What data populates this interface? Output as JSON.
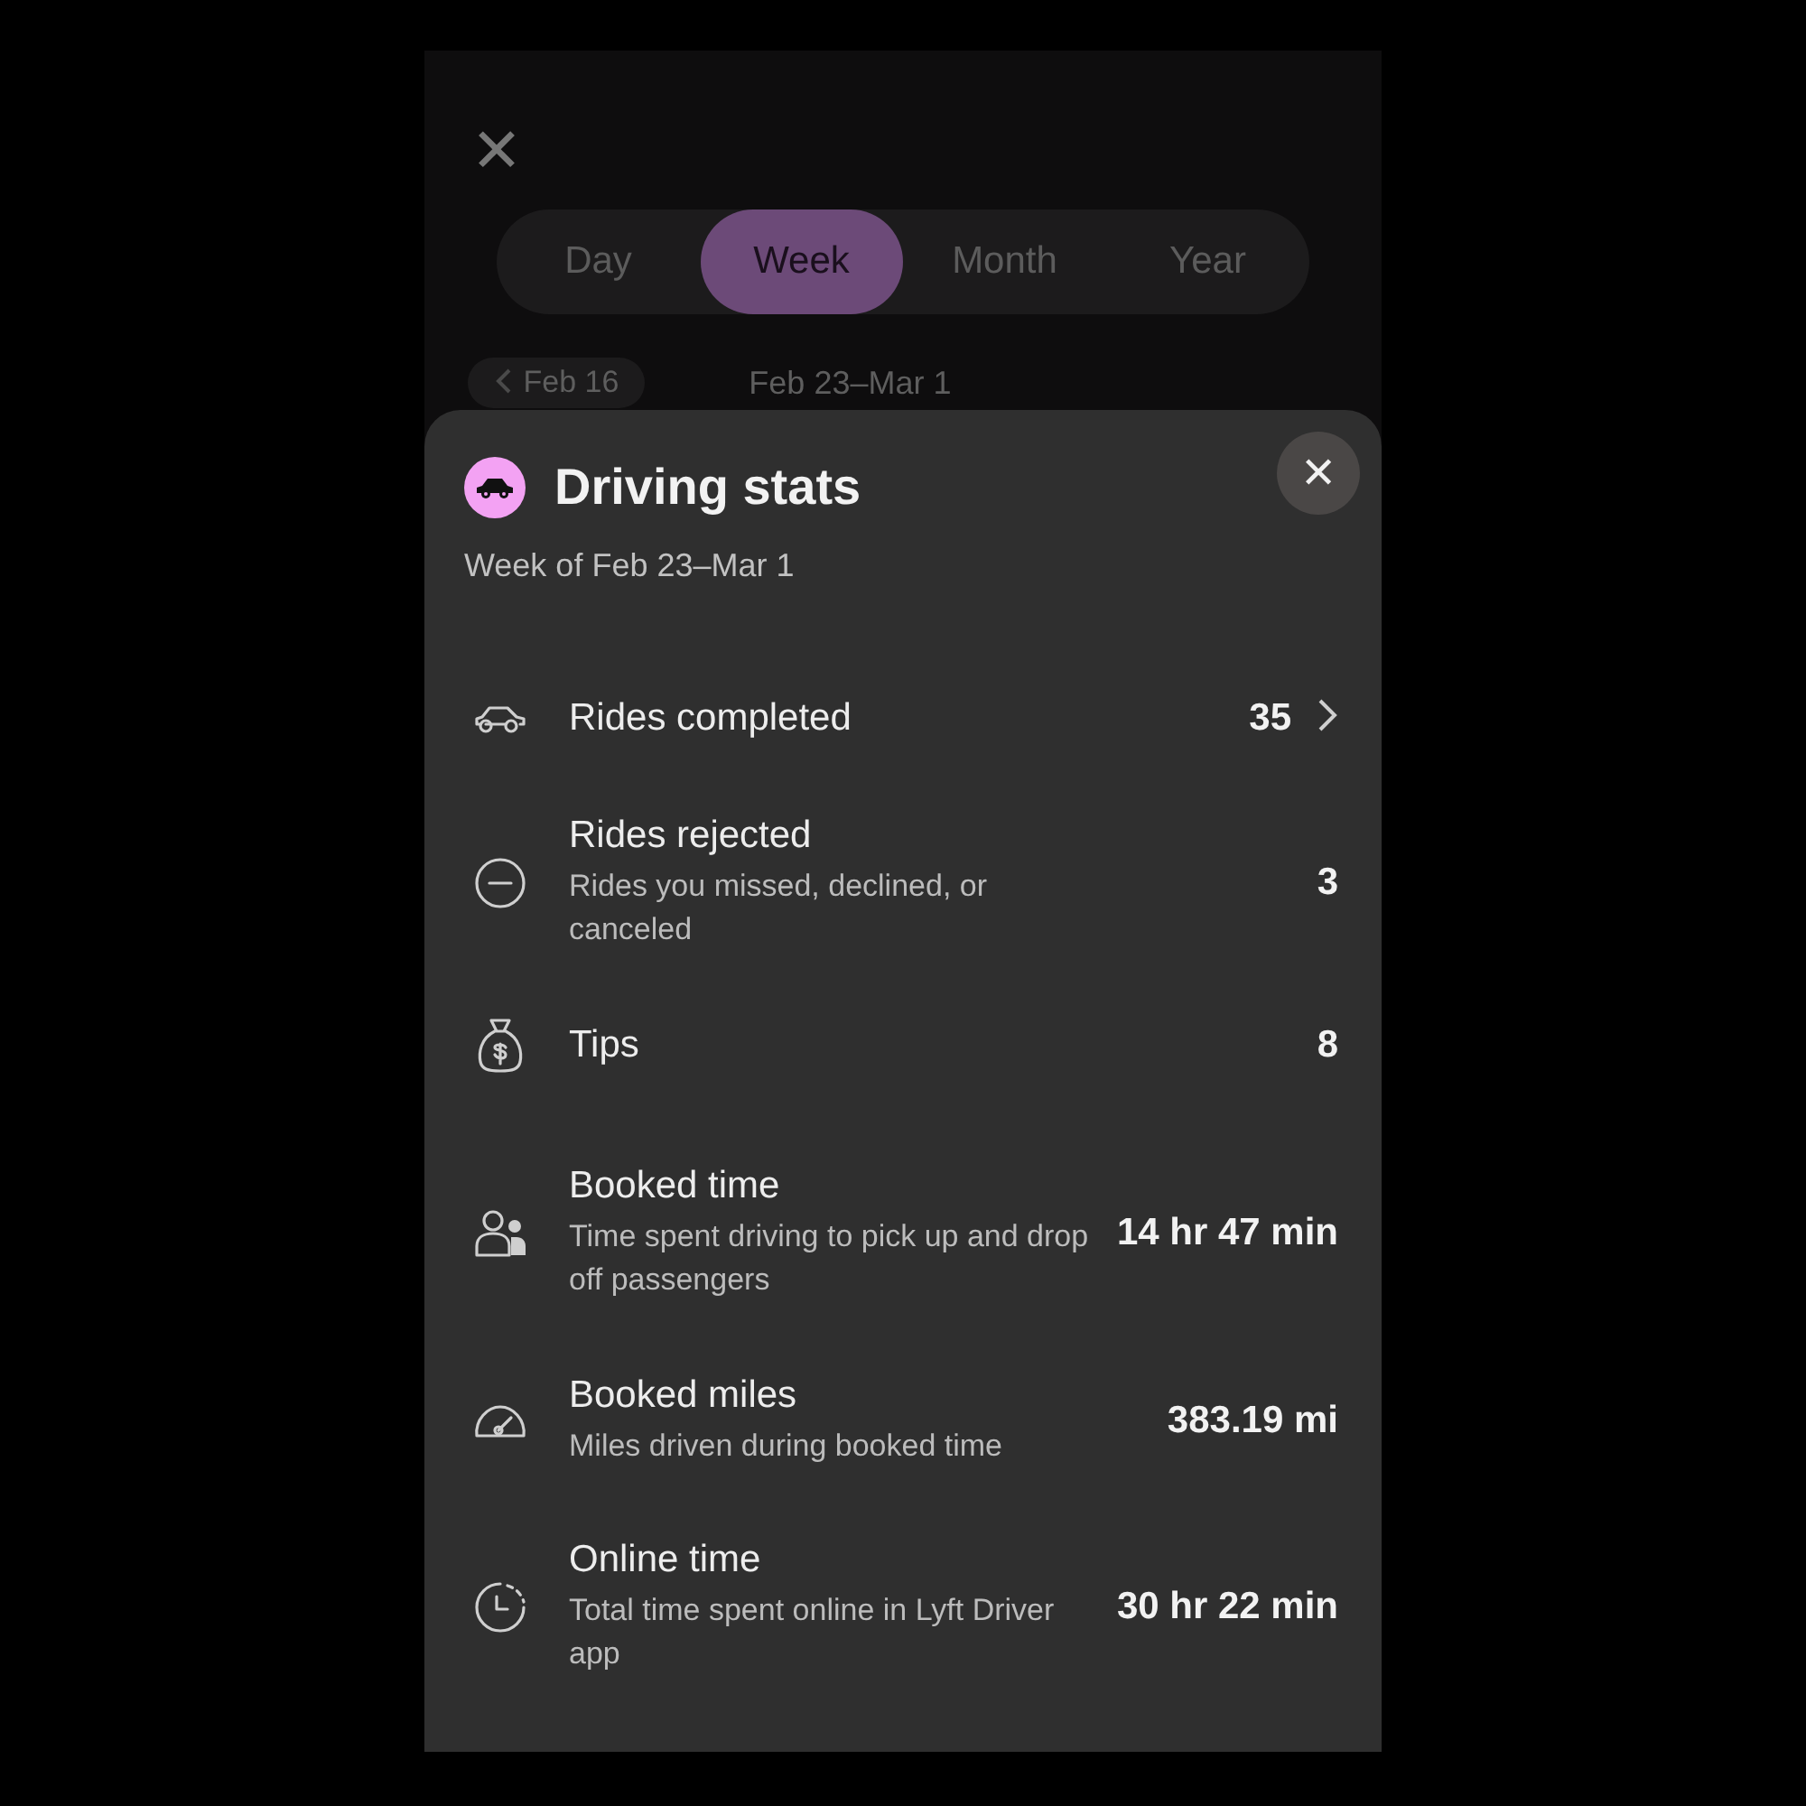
{
  "background": {
    "close_label": "✕",
    "tabs": [
      {
        "label": "Day",
        "selected": false
      },
      {
        "label": "Week",
        "selected": true
      },
      {
        "label": "Month",
        "selected": false
      },
      {
        "label": "Year",
        "selected": false
      }
    ],
    "previous_period": "Feb 16",
    "current_period": "Feb 23–Mar 1"
  },
  "sheet": {
    "title": "Driving stats",
    "subtitle": "Week of Feb 23–Mar 1",
    "stats": [
      {
        "label": "Rides completed",
        "value": "35",
        "chevron": true
      },
      {
        "label": "Rides rejected",
        "description": "Rides you missed, declined, or canceled",
        "value": "3",
        "chevron": false
      },
      {
        "label": "Tips",
        "value": "8",
        "chevron": false
      },
      {
        "label": "Booked time",
        "description": "Time spent driving to pick up and drop off passengers",
        "value": "14 hr 47 min",
        "chevron": false
      },
      {
        "label": "Booked miles",
        "description": "Miles driven during booked time",
        "value": "383.19 mi",
        "chevron": false
      },
      {
        "label": "Online time",
        "description": "Total time spent online in Lyft Driver app",
        "value": "30 hr 22 min",
        "chevron": false
      }
    ]
  }
}
